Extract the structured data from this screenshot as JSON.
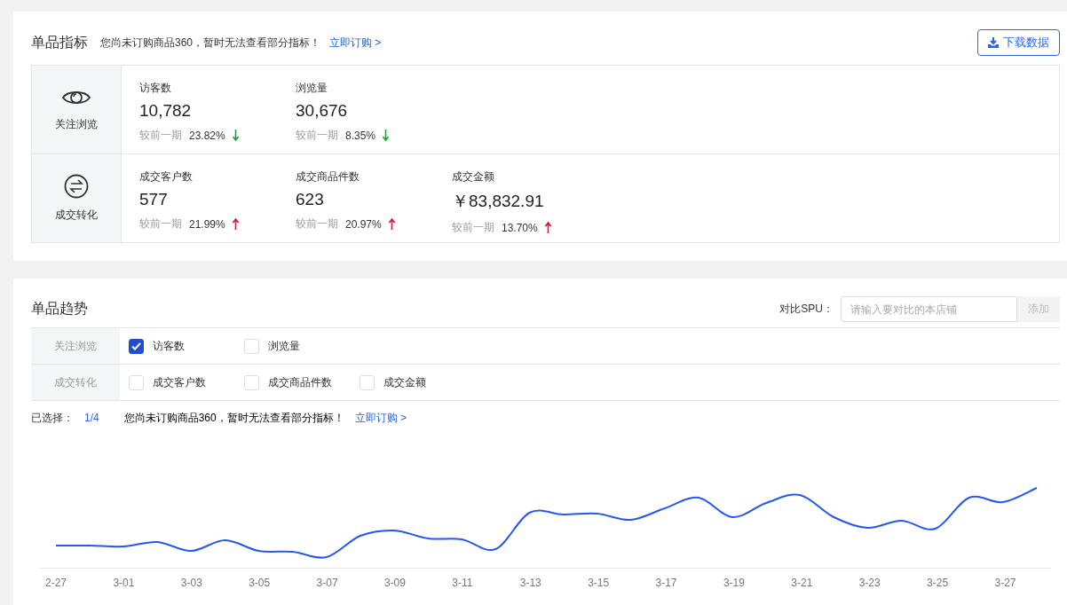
{
  "metrics_card": {
    "title": "单品指标",
    "notice": "您尚未订购商品360，暂时无法查看部分指标！",
    "notice_link": "立即订购 >",
    "download_button": "下载数据",
    "groups": [
      {
        "kind": "view",
        "label": "关注浏览",
        "metrics": [
          {
            "name": "访客数",
            "value": "10,782",
            "compare_label": "较前一期",
            "change": "23.82%",
            "rising": false
          },
          {
            "name": "浏览量",
            "value": "30,676",
            "compare_label": "较前一期",
            "change": "8.35%",
            "rising": false
          }
        ]
      },
      {
        "kind": "deal",
        "label": "成交转化",
        "metrics": [
          {
            "name": "成交客户数",
            "value": "577",
            "compare_label": "较前一期",
            "change": "21.99%",
            "rising": true
          },
          {
            "name": "成交商品件数",
            "value": "623",
            "compare_label": "较前一期",
            "change": "20.97%",
            "rising": true
          },
          {
            "name": "成交金额",
            "value": "￥83,832.91",
            "compare_label": "较前一期",
            "change": "13.70%",
            "rising": true
          }
        ]
      }
    ]
  },
  "trend_card": {
    "title": "单品趋势",
    "compare_label": "对比SPU：",
    "compare_input": {
      "placeholder": "请输入要对比的本店铺"
    },
    "add_button": "添加",
    "filters": [
      {
        "label": "关注浏览",
        "options": [
          {
            "label": "访客数",
            "checked": true
          },
          {
            "label": "浏览量",
            "checked": false
          }
        ]
      },
      {
        "label": "成交转化",
        "options": [
          {
            "label": "成交客户数",
            "checked": false
          },
          {
            "label": "成交商品件数",
            "checked": false
          },
          {
            "label": "成交金额",
            "checked": false
          }
        ]
      }
    ],
    "selected_label": "已选择：",
    "selected_count": "1/4",
    "notice": "您尚未订购商品360，暂时无法查看部分指标！",
    "notice_link": "立即订购 >",
    "x_labels": [
      "2-27",
      "3-01",
      "3-03",
      "3-05",
      "3-07",
      "3-09",
      "3-11",
      "3-13",
      "3-15",
      "3-17",
      "3-19",
      "3-21",
      "3-23",
      "3-25",
      "3-27"
    ]
  }
}
